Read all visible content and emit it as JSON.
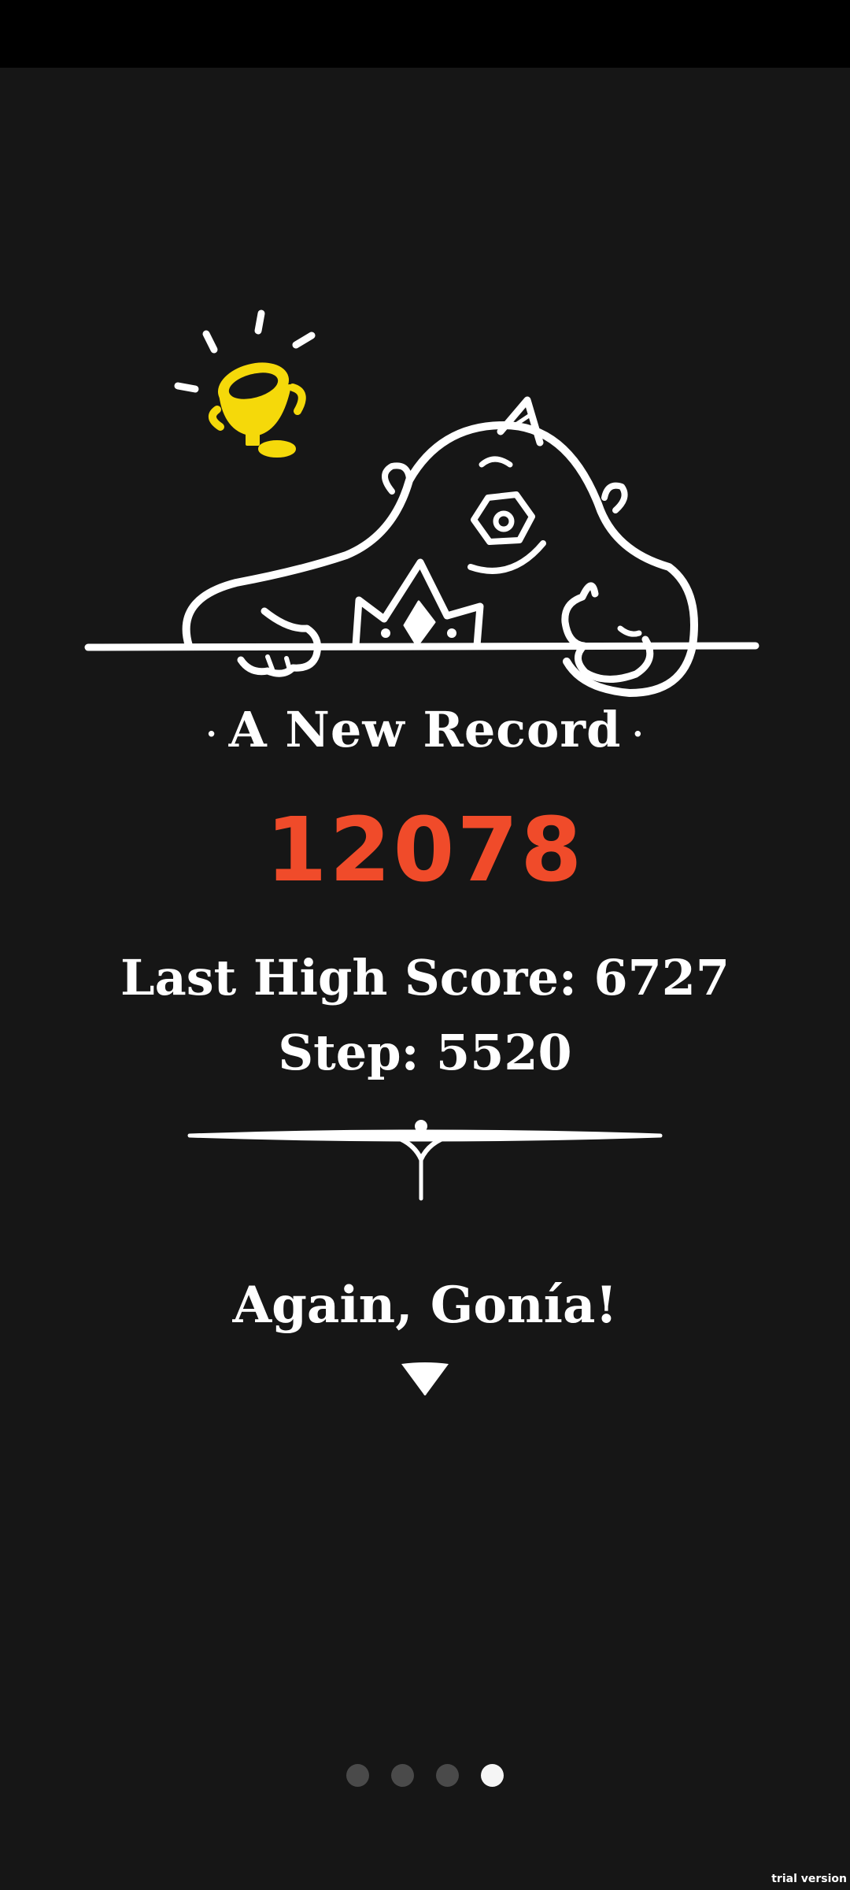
{
  "record": {
    "title": "A New Record",
    "dot_left": "·",
    "dot_right": "·"
  },
  "score": "12078",
  "stats": {
    "high_score": "Last High Score: 6727",
    "step": "Step: 5520"
  },
  "prompt": "Again, Gonía!",
  "pager": {
    "total": 4,
    "active_index": 3
  },
  "watermark": "trial version",
  "icons": {
    "illustration": "monster-with-trophy-illustration",
    "trophy": "trophy-icon",
    "divider": "ornament-divider",
    "arrow": "triangle-down-icon"
  },
  "colors": {
    "background": "#161616",
    "score": "#f04b2a",
    "trophy": "#f5d90a",
    "text": "#ffffff"
  }
}
